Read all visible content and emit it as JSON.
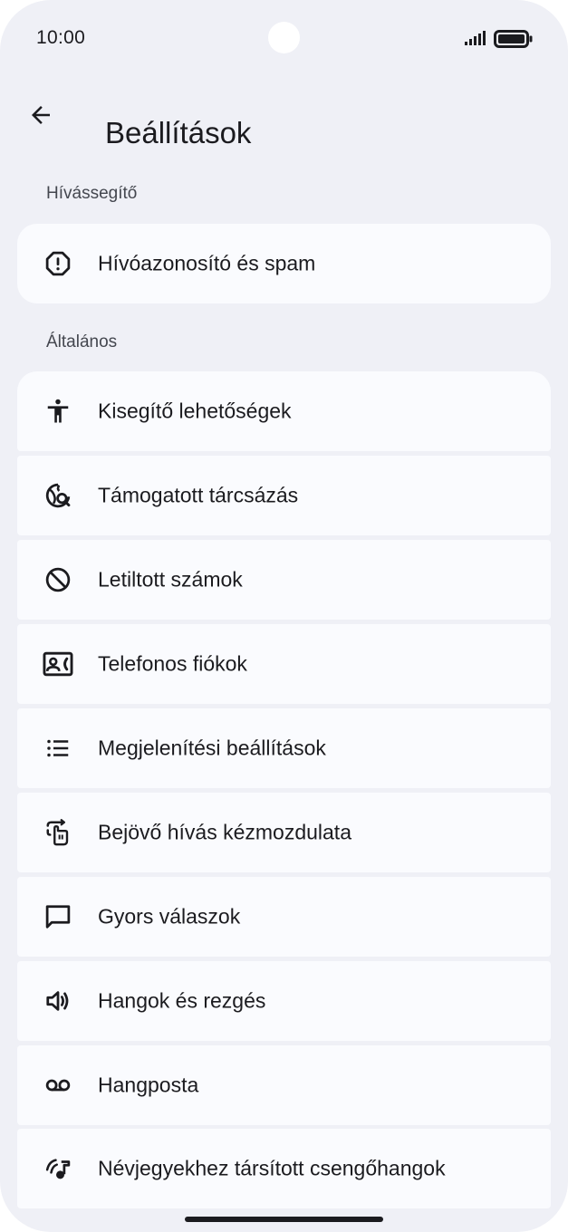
{
  "status_bar": {
    "time": "10:00"
  },
  "app_bar": {
    "title": "Beállítások"
  },
  "sections": {
    "call_assist": {
      "header": "Hívássegítő",
      "items": [
        {
          "label": "Hívóazonosító és spam",
          "icon": "spam-alert-icon"
        }
      ]
    },
    "general": {
      "header": "Általános",
      "items": [
        {
          "label": "Kisegítő lehetőségek",
          "icon": "accessibility-icon"
        },
        {
          "label": "Támogatott tárcsázás",
          "icon": "assisted-dialing-globe-icon"
        },
        {
          "label": "Letiltott számok",
          "icon": "block-icon"
        },
        {
          "label": "Telefonos fiókok",
          "icon": "phone-account-icon"
        },
        {
          "label": "Megjelenítési beállítások",
          "icon": "list-icon"
        },
        {
          "label": "Bejövő hívás kézmozdulata",
          "icon": "swipe-gesture-icon"
        },
        {
          "label": "Gyors válaszok",
          "icon": "chat-bubble-icon"
        },
        {
          "label": "Hangok és rezgés",
          "icon": "volume-icon"
        },
        {
          "label": "Hangposta",
          "icon": "voicemail-icon"
        },
        {
          "label": "Névjegyekhez társított csengőhangok",
          "icon": "contact-ringtone-icon"
        }
      ]
    }
  },
  "colors": {
    "background": "#eff0f6",
    "card": "#fafbfe",
    "text_primary": "#1b1b1f",
    "text_secondary": "#44474f"
  }
}
